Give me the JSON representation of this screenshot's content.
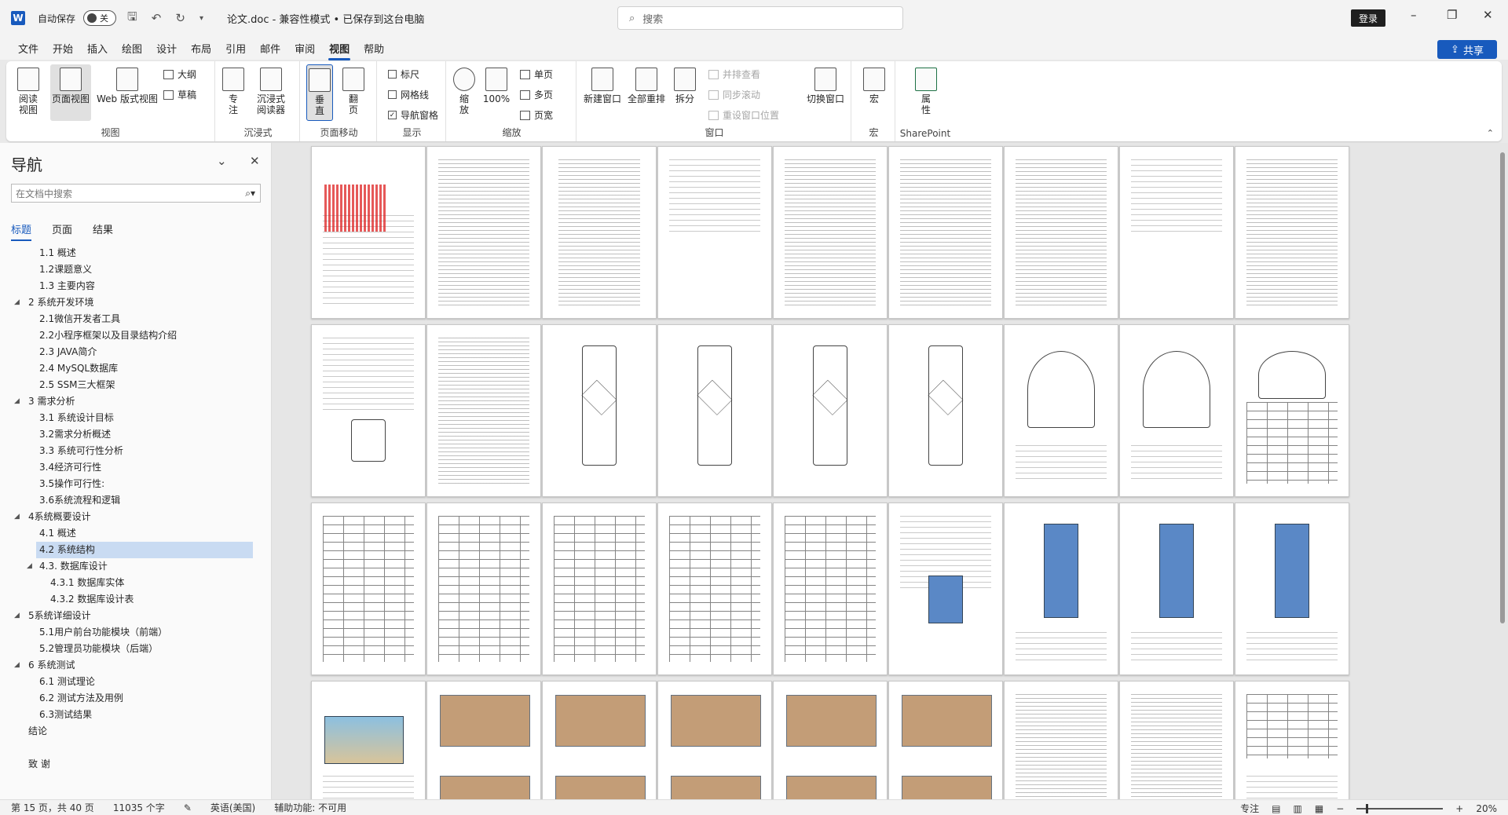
{
  "titlebar": {
    "autosave_label": "自动保存",
    "autosave_state": "关",
    "doc_title": "论文.doc  -  兼容性模式 • 已保存到这台电脑",
    "search_placeholder": "搜索",
    "login": "登录"
  },
  "menu": [
    "文件",
    "开始",
    "插入",
    "绘图",
    "设计",
    "布局",
    "引用",
    "邮件",
    "审阅",
    "视图",
    "帮助"
  ],
  "menu_active": "视图",
  "share": "共享",
  "ribbon": {
    "views": {
      "label": "视图",
      "read": "阅读视图",
      "print": "页面视图",
      "web": "Web 版式视图",
      "outline": "大纲",
      "draft": "草稿"
    },
    "immersive": {
      "label": "沉浸式",
      "focus": "专注",
      "reader": "沉浸式阅读器"
    },
    "pagemove": {
      "label": "页面移动",
      "vertical": "垂直",
      "sidetoside": "翻页"
    },
    "show": {
      "label": "显示",
      "ruler": "标尺",
      "gridlines": "网格线",
      "navpane": "导航窗格",
      "navpane_checked": "✓"
    },
    "zoom": {
      "label": "缩放",
      "zoom": "缩放",
      "hundred": "100%",
      "onepage": "单页",
      "multipage": "多页",
      "pagewidth": "页宽"
    },
    "window": {
      "label": "窗口",
      "newwin": "新建窗口",
      "arrange": "全部重排",
      "split": "拆分",
      "sidebyside": "并排查看",
      "syncscroll": "同步滚动",
      "resetpos": "重设窗口位置",
      "switch": "切换窗口"
    },
    "macros": {
      "label": "宏",
      "macros": "宏"
    },
    "sharepoint": {
      "label": "SharePoint",
      "props": "属性"
    }
  },
  "nav": {
    "title": "导航",
    "search_placeholder": "在文档中搜索",
    "tabs": [
      "标题",
      "页面",
      "结果"
    ],
    "headings": [
      {
        "t": "1.1 概述",
        "lv": 2
      },
      {
        "t": "1.2课题意义",
        "lv": 2
      },
      {
        "t": "1.3 主要内容",
        "lv": 2
      },
      {
        "t": "2 系统开发环境",
        "lv": 1
      },
      {
        "t": "2.1微信开发者工具",
        "lv": 2
      },
      {
        "t": "2.2小程序框架以及目录结构介绍",
        "lv": 2
      },
      {
        "t": "2.3 JAVA简介",
        "lv": 2
      },
      {
        "t": "2.4 MySQL数据库",
        "lv": 2
      },
      {
        "t": "2.5 SSM三大框架",
        "lv": 2
      },
      {
        "t": "3 需求分析",
        "lv": 1
      },
      {
        "t": "3.1 系统设计目标",
        "lv": 2
      },
      {
        "t": "3.2需求分析概述",
        "lv": 2
      },
      {
        "t": "3.3 系统可行性分析",
        "lv": 2
      },
      {
        "t": "3.4经济可行性",
        "lv": 2
      },
      {
        "t": "3.5操作可行性:",
        "lv": 2
      },
      {
        "t": "3.6系统流程和逻辑",
        "lv": 2
      },
      {
        "t": "4系统概要设计",
        "lv": 1
      },
      {
        "t": "4.1 概述",
        "lv": 2
      },
      {
        "t": "4.2 系统结构",
        "lv": 2,
        "sel": true
      },
      {
        "t": "4.3. 数据库设计",
        "lv": 2,
        "ex": true
      },
      {
        "t": "4.3.1 数据库实体",
        "lv": 3
      },
      {
        "t": "4.3.2 数据库设计表",
        "lv": 3
      },
      {
        "t": "5系统详细设计",
        "lv": 1
      },
      {
        "t": "5.1用户前台功能模块（前端）",
        "lv": 2
      },
      {
        "t": "5.2管理员功能模块（后端）",
        "lv": 2
      },
      {
        "t": "6 系统测试",
        "lv": 1
      },
      {
        "t": "6.1 测试理论",
        "lv": 2
      },
      {
        "t": "6.2 测试方法及用例",
        "lv": 2
      },
      {
        "t": "6.3测试结果",
        "lv": 2
      },
      {
        "t": "结论",
        "lv": 0
      },
      {
        "t": "",
        "lv": 0
      },
      {
        "t": "致 谢",
        "lv": 0
      }
    ]
  },
  "pages": [
    "text-red",
    "text",
    "toc",
    "text-sparse",
    "text",
    "text",
    "text",
    "text-sparse",
    "text",
    "text-flow",
    "text",
    "flow",
    "flow",
    "flow",
    "flow",
    "tree",
    "tree",
    "tree-table",
    "table",
    "table",
    "table",
    "table",
    "table",
    "text-img",
    "img",
    "img",
    "img",
    "beach",
    "brown",
    "brown",
    "brown",
    "brown",
    "brown",
    "text",
    "text",
    "text-table"
  ],
  "status": {
    "page": "第 15 页，共 40 页",
    "words": "11035 个字",
    "lang": "英语(美国)",
    "access": "辅助功能: 不可用",
    "focus": "专注",
    "zoom": "20%"
  }
}
